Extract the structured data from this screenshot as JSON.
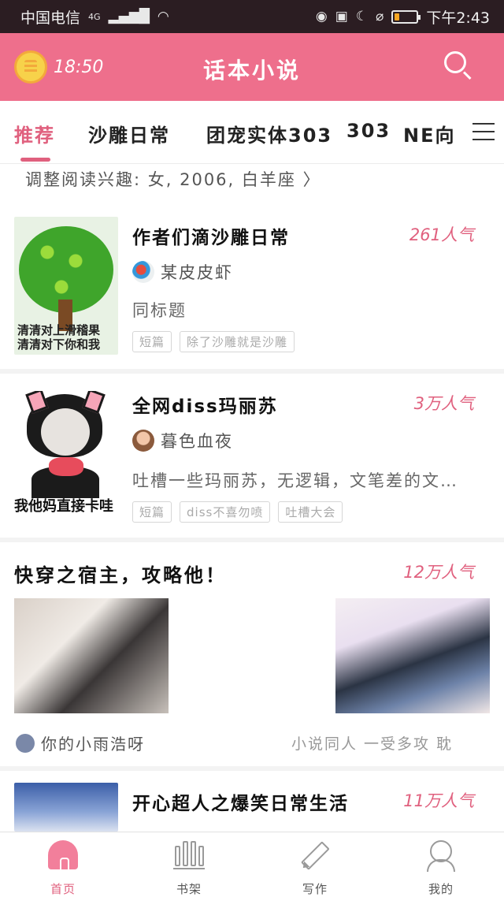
{
  "status_bar": {
    "carrier": "中国电信",
    "network": "4G",
    "time": "下午2:43"
  },
  "header": {
    "timer_text": "18:50",
    "title": "话本小说"
  },
  "tabs": [
    {
      "label": "推荐",
      "active": true
    },
    {
      "label": "沙雕日常",
      "active": false
    },
    {
      "label": "团宠实体303",
      "active": false
    },
    {
      "label": "303",
      "active": false
    },
    {
      "label": "NE向",
      "active": false
    }
  ],
  "interest": {
    "text": "调整阅读兴趣: 女, 2006, 白羊座 〉"
  },
  "feed": [
    {
      "title": "作者们滴沙雕日常",
      "popularity": "261人气",
      "author": "某皮皮虾",
      "description": "同标题",
      "tags": [
        "短篇",
        "除了沙雕就是沙雕"
      ],
      "thumb_caption_1": "清清对上滑稽果",
      "thumb_caption_2": "清清对下你和我"
    },
    {
      "title": "全网diss玛丽苏",
      "popularity": "3万人气",
      "author": "暮色血夜",
      "description": "吐槽一些玛丽苏，无逻辑，文笔差的文…",
      "tags": [
        "短篇",
        "diss不喜勿喷",
        "吐槽大会"
      ],
      "thumb_caption": "我他妈直接卡哇"
    },
    {
      "title": "快穿之宿主，攻略他！",
      "popularity": "12万人气",
      "author": "你的小雨浩呀",
      "tags_text": "小说同人   一受多攻   耽"
    },
    {
      "title": "开心超人之爆笑日常生活",
      "popularity": "11万人气"
    }
  ],
  "bottom_nav": [
    {
      "label": "首页",
      "icon": "home-icon",
      "active": true
    },
    {
      "label": "书架",
      "icon": "bookshelf-icon",
      "active": false
    },
    {
      "label": "写作",
      "icon": "pen-icon",
      "active": false
    },
    {
      "label": "我的",
      "icon": "profile-icon",
      "active": false
    }
  ],
  "colors": {
    "accent": "#e0607e",
    "header_bg": "#ee6f8c",
    "status_bg": "#2b1d22"
  }
}
